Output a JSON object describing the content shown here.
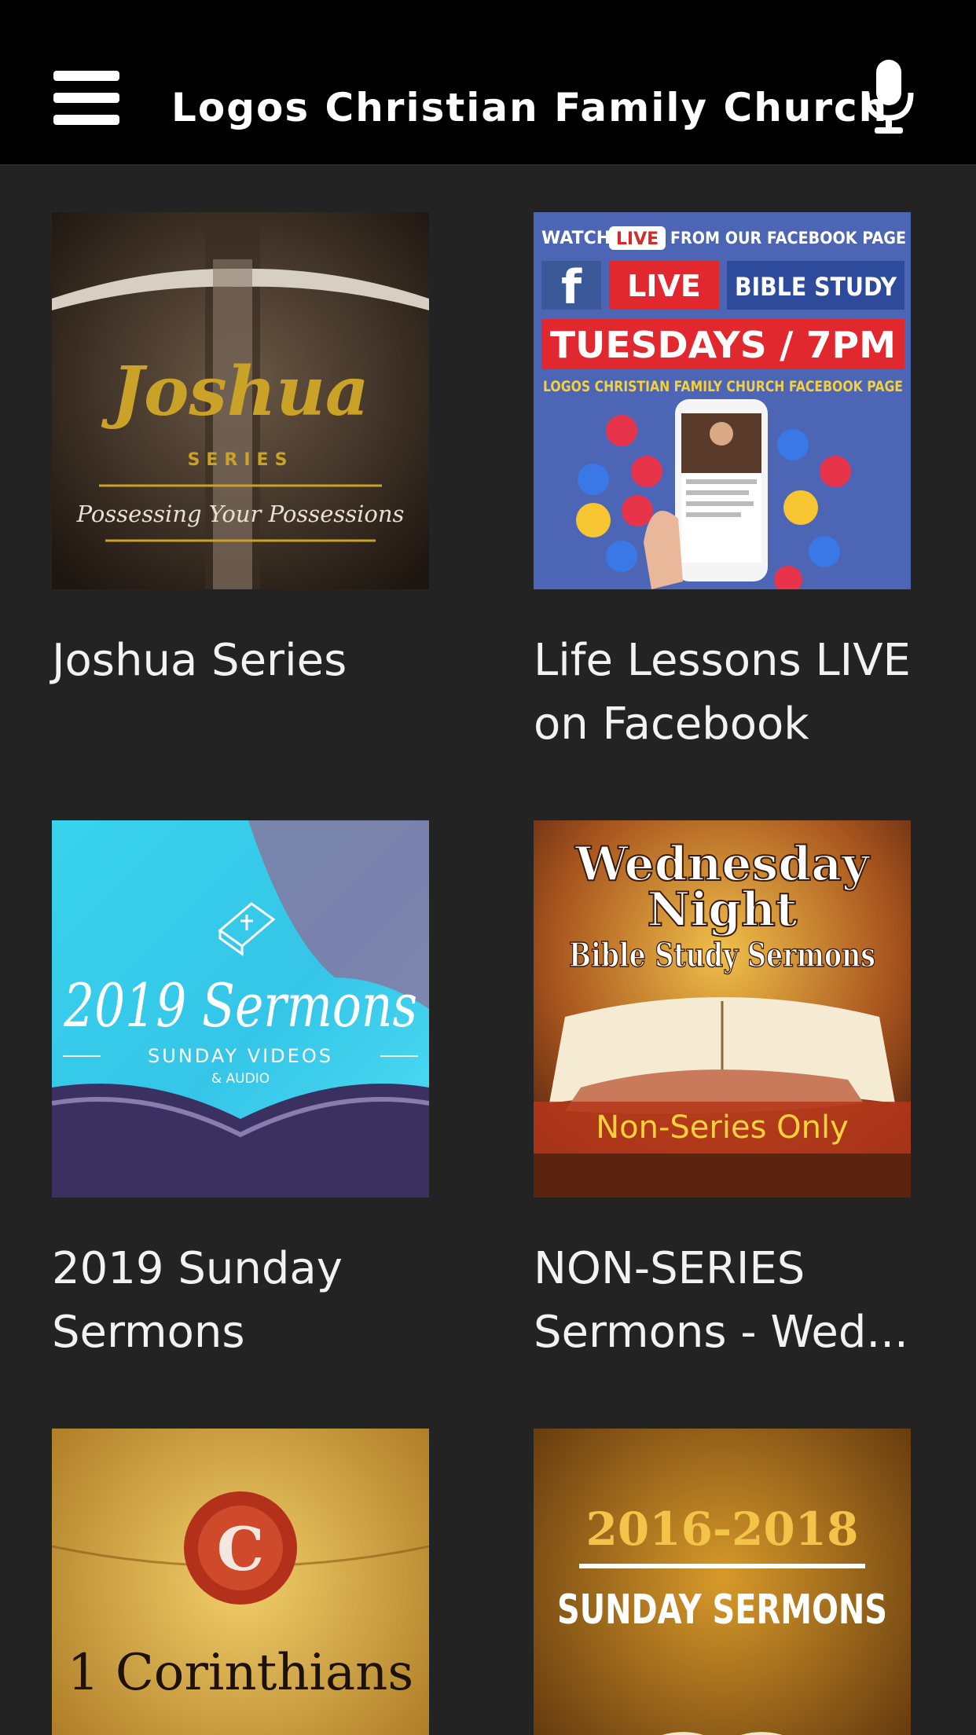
{
  "header": {
    "menu_icon": "hamburger-menu-icon",
    "title": "Logos Christian Family Church",
    "mic_icon": "microphone-icon",
    "bg": "#000000"
  },
  "colors": {
    "background": "#232323",
    "text": "#f2f2f2"
  },
  "cards": [
    {
      "caption": "Joshua Series",
      "art": {
        "big": "Joshua",
        "small": "SERIES",
        "tagline": "Possessing Your Possessions"
      }
    },
    {
      "caption": "Life Lessons LIVE on Facebook",
      "art": {
        "watch": "WATCH",
        "watch_live": "LIVE",
        "watch_rest": "FROM OUR FACEBOOK PAGE",
        "fb": "f",
        "live": "LIVE",
        "bible": "BIBLE STUDY",
        "when": "TUESDAYS / 7PM",
        "page": "LOGOS CHRISTIAN FAMILY CHURCH FACEBOOK PAGE"
      }
    },
    {
      "caption": "2019 Sunday Sermons",
      "art": {
        "big": "2019 Sermons",
        "sub": "SUNDAY VIDEOS",
        "sub2": "& AUDIO"
      }
    },
    {
      "caption": "NON-SERIES Sermons - Wed...",
      "art": {
        "line1": "Wednesday",
        "line2": "Night",
        "line3": "Bible Study Sermons",
        "band": "Non-Series Only"
      }
    },
    {
      "caption": "",
      "art": {
        "seal": "C",
        "title": "1 Corinthians"
      }
    },
    {
      "caption": "",
      "art": {
        "years": "2016-2018",
        "title": "SUNDAY SERMONS"
      }
    }
  ]
}
